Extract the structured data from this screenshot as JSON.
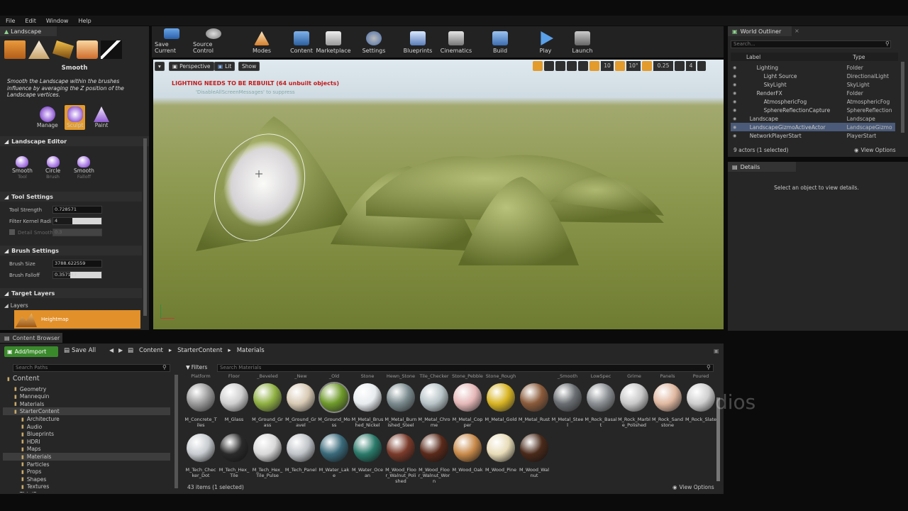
{
  "menu": [
    "File",
    "Edit",
    "Window",
    "Help"
  ],
  "mode_tab": "Landscape",
  "mode_sub": "Smooth",
  "mode_desc": "Smooth the Landscape within the brushes influence by averaging the Z position of the Landscape vertices.",
  "mode_tabs": [
    "Manage",
    "Sculpt",
    "Paint"
  ],
  "landscape_editor": "Landscape Editor",
  "tools": [
    {
      "name": "Smooth",
      "sub": "Tool"
    },
    {
      "name": "Circle",
      "sub": "Brush"
    },
    {
      "name": "Smooth",
      "sub": "Falloff"
    }
  ],
  "tool_settings": "Tool Settings",
  "tool_props": [
    {
      "label": "Tool Strength",
      "value": "0.728571"
    },
    {
      "label": "Filter Kernel Radi",
      "value": "4"
    },
    {
      "label": "Detail Smooth",
      "value": "0.3"
    }
  ],
  "brush_settings": "Brush Settings",
  "brush_props": [
    {
      "label": "Brush Size",
      "value": "3788.622559"
    },
    {
      "label": "Brush Falloff",
      "value": "0.357143"
    }
  ],
  "target_layers": "Target Layers",
  "layers": "Layers",
  "heightmap": "Heightmap",
  "toolbar": [
    "Save Current",
    "Source Control",
    "Modes",
    "Content",
    "Marketplace",
    "Settings",
    "Blueprints",
    "Cinematics",
    "Build",
    "Play",
    "Launch"
  ],
  "viewport": {
    "perspective": "Perspective",
    "lit": "Lit",
    "show": "Show",
    "warning": "LIGHTING NEEDS TO BE REBUILT (64 unbuilt objects)",
    "warning_sub": "'DisableAllScreenMessages' to suppress",
    "grid": "10",
    "angle": "10°",
    "scale": "0.25",
    "cam": "4"
  },
  "outliner": {
    "title": "World Outliner",
    "search": "Search...",
    "col_label": "Label",
    "col_type": "Type",
    "rows": [
      {
        "label": "Lighting",
        "type": "Folder",
        "indent": 2
      },
      {
        "label": "Light Source",
        "type": "DirectionalLight",
        "indent": 3
      },
      {
        "label": "SkyLight",
        "type": "SkyLight",
        "indent": 3
      },
      {
        "label": "RenderFX",
        "type": "Folder",
        "indent": 2
      },
      {
        "label": "AtmosphericFog",
        "type": "AtmosphericFog",
        "indent": 3
      },
      {
        "label": "SphereReflectionCapture",
        "type": "SphereReflection",
        "indent": 3
      },
      {
        "label": "Landscape",
        "type": "Landscape",
        "indent": 1
      },
      {
        "label": "LandscapeGizmoActiveActor",
        "type": "LandscapeGizmo",
        "indent": 1
      },
      {
        "label": "NetworkPlayerStart",
        "type": "PlayerStart",
        "indent": 1
      }
    ],
    "count": "9 actors (1 selected)",
    "view_options": "View Options"
  },
  "details": {
    "title": "Details",
    "empty": "Select an object to view details."
  },
  "content_browser": {
    "tab": "Content Browser",
    "add": "Add/Import",
    "save_all": "Save All",
    "crumbs": [
      "Content",
      "StarterContent",
      "Materials"
    ],
    "search_paths": "Search Paths",
    "filters": "Filters",
    "search_materials": "Search Materials",
    "tree": [
      "Content",
      "Geometry",
      "Mannequin",
      "Materials",
      "StarterContent",
      "Architecture",
      "Audio",
      "Blueprints",
      "HDRI",
      "Maps",
      "Materials",
      "Particles",
      "Props",
      "Shapes",
      "Textures",
      "ThirdPerson"
    ],
    "count": "43 items (1 selected)",
    "view_options": "View Options",
    "top_labels": [
      "Platform",
      "Floor",
      "_Beveled",
      "_New",
      "_Old",
      "Stone",
      "Hewn_Stone",
      "Tile_Checker",
      "Stone_Pebble",
      "Stone_Rough",
      "_Smooth",
      "LowSpec",
      "Grime",
      "Panels",
      "Poured"
    ],
    "row1": [
      "M_Concrete_Tiles",
      "M_Glass",
      "M_Ground_Grass",
      "M_Ground_Gravel",
      "M_Ground_Moss",
      "M_Metal_Brushed_Nickel",
      "M_Metal_Burnished_Steel",
      "M_Metal_Chrome",
      "M_Metal_Copper",
      "M_Metal_Gold",
      "M_Metal_Rust",
      "M_Metal_Steel",
      "M_Rock_Basalt",
      "M_Rock_Marble_Polished",
      "M_Rock_Sandstone",
      "M_Rock_Slate"
    ],
    "row2": [
      "M_Tech_Checker_Dot",
      "M_Tech_Hex_Tile",
      "M_Tech_Hex_Tile_Pulse",
      "M_Tech_Panel",
      "M_Water_Lake",
      "M_Water_Ocean",
      "M_Wood_Floor_Walnut_Polished",
      "M_Wood_Floor_Walnut_Worn",
      "M_Wood_Oak",
      "M_Wood_Pine",
      "M_Wood_Walnut"
    ]
  },
  "watermark": "dios"
}
